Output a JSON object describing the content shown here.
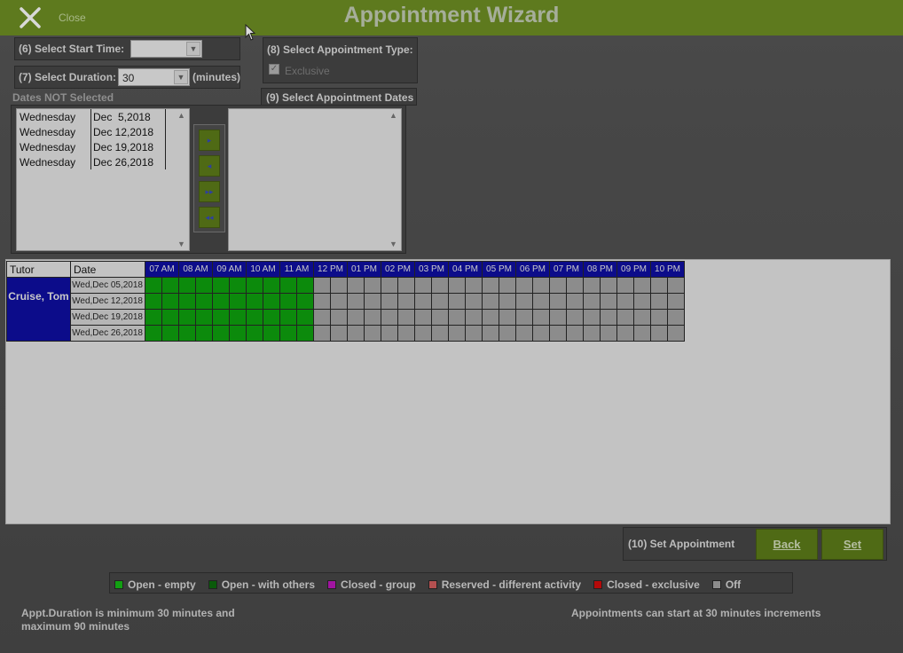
{
  "window": {
    "title": "Appointment Wizard",
    "close_label": "Close"
  },
  "start_time": {
    "label": "(6) Select Start Time:",
    "value": ""
  },
  "duration": {
    "label": "(7) Select Duration:",
    "value": "30",
    "unit": "(minutes)"
  },
  "appt_type": {
    "label": "(8) Select Appointment Type:",
    "exclusive_label": "Exclusive",
    "exclusive_checked": true
  },
  "dates_not_selected": {
    "label": "Dates NOT Selected",
    "items": [
      {
        "day": "Wednesday",
        "date": "Dec  5,2018"
      },
      {
        "day": "Wednesday",
        "date": "Dec 12,2018"
      },
      {
        "day": "Wednesday",
        "date": "Dec 19,2018"
      },
      {
        "day": "Wednesday",
        "date": "Dec 26,2018"
      }
    ]
  },
  "select_dates_label": "(9) Select Appointment Dates",
  "move_buttons": [
    "▸",
    "◂",
    "▸▸",
    "◂◂"
  ],
  "grid": {
    "tutor_header": "Tutor",
    "date_header": "Date",
    "hours": [
      "07 AM",
      "08 AM",
      "09 AM",
      "10 AM",
      "11 AM",
      "12 PM",
      "01 PM",
      "02 PM",
      "03 PM",
      "04 PM",
      "05 PM",
      "06 PM",
      "07 PM",
      "08 PM",
      "09 PM",
      "10 PM"
    ],
    "tutor": "Cruise, Tom",
    "rows": [
      {
        "date": "Wed,Dec 05,2018"
      },
      {
        "date": "Wed,Dec 12,2018"
      },
      {
        "date": "Wed,Dec 19,2018"
      },
      {
        "date": "Wed,Dec 26,2018"
      }
    ],
    "open_slots_per_row": 10,
    "total_slots_per_row": 32,
    "colors": {
      "open": "#0c8a0c",
      "off": "#8c8c8c",
      "header": "#0c0c8a"
    }
  },
  "set_appointment": {
    "label": "(10) Set Appointment",
    "back": "Back",
    "set": "Set"
  },
  "legend": [
    {
      "label": "Open - empty",
      "color": "#12a012"
    },
    {
      "label": "Open - with others",
      "color": "#0a5a0a"
    },
    {
      "label": "Closed - group",
      "color": "#a014a0"
    },
    {
      "label": "Reserved - different activity",
      "color": "#b45050"
    },
    {
      "label": "Closed - exclusive",
      "color": "#b40a0a"
    },
    {
      "label": "Off",
      "color": "#8c8c8c"
    }
  ],
  "notes": {
    "duration": "Appt.Duration is minimum 30 minutes and maximum 90 minutes",
    "increments": "Appointments can start at 30 minutes increments"
  }
}
